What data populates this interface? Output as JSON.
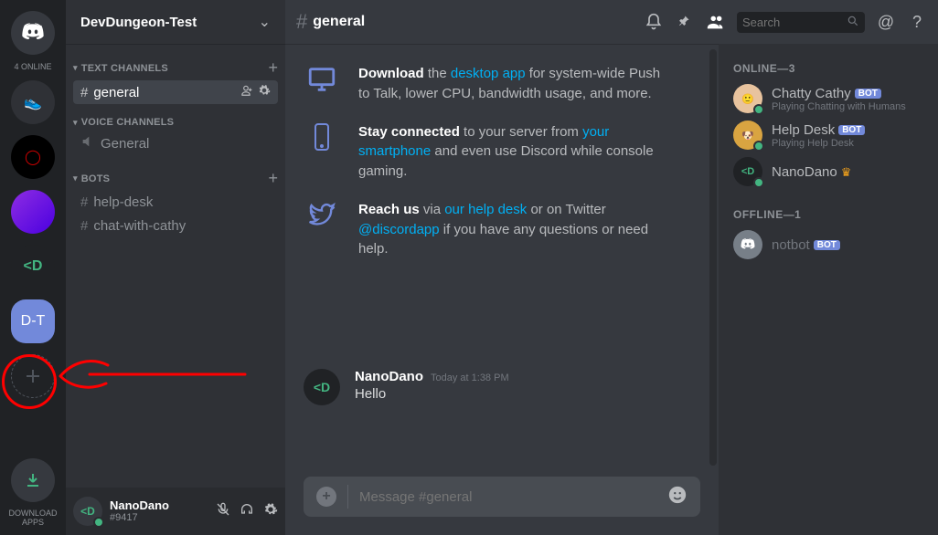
{
  "rail": {
    "online_label": "4 ONLINE",
    "servers": [
      "",
      "",
      "",
      "<D"
    ],
    "selected_label": "D-T",
    "download_label": "DOWNLOAD APPS"
  },
  "server": {
    "name": "DevDungeon-Test"
  },
  "categories": {
    "text_label": "TEXT CHANNELS",
    "voice_label": "VOICE CHANNELS",
    "bots_label": "BOTS"
  },
  "channels": {
    "general": "general",
    "voice_general": "General",
    "help_desk": "help-desk",
    "chat_cathy": "chat-with-cathy"
  },
  "user": {
    "name": "NanoDano",
    "tag": "#9417"
  },
  "topbar": {
    "channel": "general",
    "search_placeholder": "Search"
  },
  "welcome": {
    "download_bold": "Download",
    "download_rest1": " the ",
    "download_link": "desktop app",
    "download_rest2": " for system-wide Push to Talk, lower CPU, bandwidth usage, and more.",
    "stay_bold": "Stay connected",
    "stay_rest1": " to your server from ",
    "stay_link": "your smartphone",
    "stay_rest2": " and even use Discord while console gaming.",
    "reach_bold": "Reach us",
    "reach_rest1": " via ",
    "reach_link1": "our help desk",
    "reach_rest2": " or on Twitter ",
    "reach_link2": "@discordapp",
    "reach_rest3": " if you have any questions or need help."
  },
  "message": {
    "author": "NanoDano",
    "timestamp": "Today at 1:38 PM",
    "text": "Hello"
  },
  "compose": {
    "placeholder": "Message #general"
  },
  "members": {
    "online_header": "ONLINE—3",
    "offline_header": "OFFLINE—1",
    "cathy": {
      "name": "Chatty Cathy",
      "status": "Playing Chatting with Humans",
      "bot": "BOT"
    },
    "helpdesk": {
      "name": "Help Desk",
      "status": "Playing Help Desk",
      "bot": "BOT"
    },
    "nano": {
      "name": "NanoDano"
    },
    "notbot": {
      "name": "notbot",
      "bot": "BOT"
    }
  }
}
